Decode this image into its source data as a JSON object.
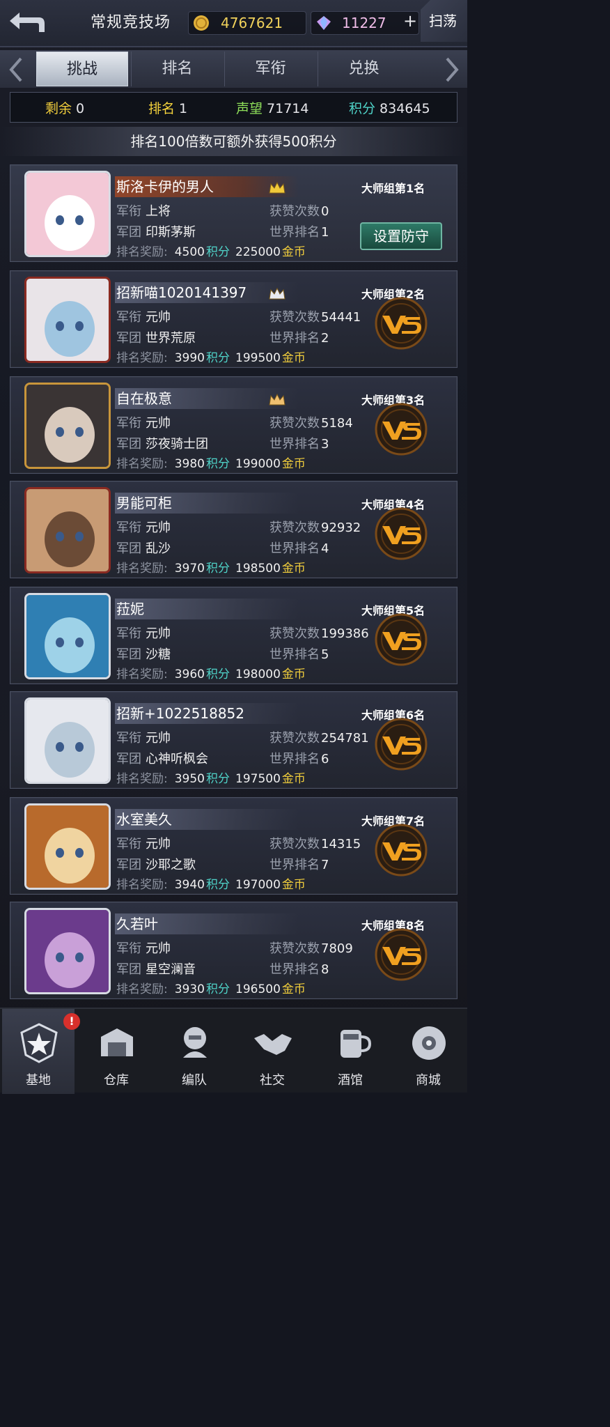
{
  "header": {
    "title": "常规竞技场",
    "gold": "4767621",
    "gems": "11227",
    "plus": "+",
    "sweep": "扫荡"
  },
  "tabs": [
    {
      "label": "挑战",
      "active": true
    },
    {
      "label": "排名",
      "active": false
    },
    {
      "label": "军衔",
      "active": false
    },
    {
      "label": "兑换",
      "active": false
    }
  ],
  "stats": {
    "remaining_label": "剩余",
    "remaining": "0",
    "rank_label": "排名",
    "rank": "1",
    "prestige_label": "声望",
    "prestige": "71714",
    "points_label": "积分",
    "points": "834645"
  },
  "hint": "排名100倍数可额外获得500积分",
  "labels": {
    "rank_title": "军衔",
    "legion": "军团",
    "likes": "获赞次数",
    "world_rank": "世界排名",
    "reward": "排名奖励:",
    "points_unit": "积分",
    "gold_unit": "金币",
    "set_defense": "设置防守"
  },
  "colors": {
    "accent_teal": "#4fd3c8",
    "gold_text": "#f0cd3c",
    "prestige_green": "#8fe05a"
  },
  "players": [
    {
      "name": "斯洛卡伊的男人",
      "group": "大师组第1名",
      "rank_title": "上将",
      "legion": "印斯茅斯",
      "likes": "0",
      "world_rank": "1",
      "reward_points": "4500",
      "reward_gold": "225000",
      "crown": "1",
      "me": true
    },
    {
      "name": "招新喵1020141397",
      "group": "大师组第2名",
      "rank_title": "元帅",
      "legion": "世界荒原",
      "likes": "54441",
      "world_rank": "2",
      "reward_points": "3990",
      "reward_gold": "199500",
      "crown": "2"
    },
    {
      "name": "自在极意",
      "group": "大师组第3名",
      "rank_title": "元帅",
      "legion": "莎夜骑士团",
      "likes": "5184",
      "world_rank": "3",
      "reward_points": "3980",
      "reward_gold": "199000",
      "crown": "3"
    },
    {
      "name": "男能可柜",
      "group": "大师组第4名",
      "rank_title": "元帅",
      "legion": "乱沙",
      "likes": "92932",
      "world_rank": "4",
      "reward_points": "3970",
      "reward_gold": "198500"
    },
    {
      "name": "菈妮",
      "group": "大师组第5名",
      "rank_title": "元帅",
      "legion": "沙糖",
      "likes": "199386",
      "world_rank": "5",
      "reward_points": "3960",
      "reward_gold": "198000"
    },
    {
      "name": "招新+1022518852",
      "group": "大师组第6名",
      "rank_title": "元帅",
      "legion": "心神听枫会",
      "likes": "254781",
      "world_rank": "6",
      "reward_points": "3950",
      "reward_gold": "197500"
    },
    {
      "name": "水室美久",
      "group": "大师组第7名",
      "rank_title": "元帅",
      "legion": "沙耶之歌",
      "likes": "14315",
      "world_rank": "7",
      "reward_points": "3940",
      "reward_gold": "197000"
    },
    {
      "name": "久若叶",
      "group": "大师组第8名",
      "rank_title": "元帅",
      "legion": "星空澜音",
      "likes": "7809",
      "world_rank": "8",
      "reward_points": "3930",
      "reward_gold": "196500"
    }
  ],
  "nav": [
    {
      "label": "基地",
      "icon": "base-star-icon",
      "active": true,
      "badge": "!"
    },
    {
      "label": "仓库",
      "icon": "warehouse-icon"
    },
    {
      "label": "编队",
      "icon": "formation-icon"
    },
    {
      "label": "社交",
      "icon": "handshake-icon"
    },
    {
      "label": "酒馆",
      "icon": "tavern-icon"
    },
    {
      "label": "商城",
      "icon": "shop-icon"
    }
  ]
}
